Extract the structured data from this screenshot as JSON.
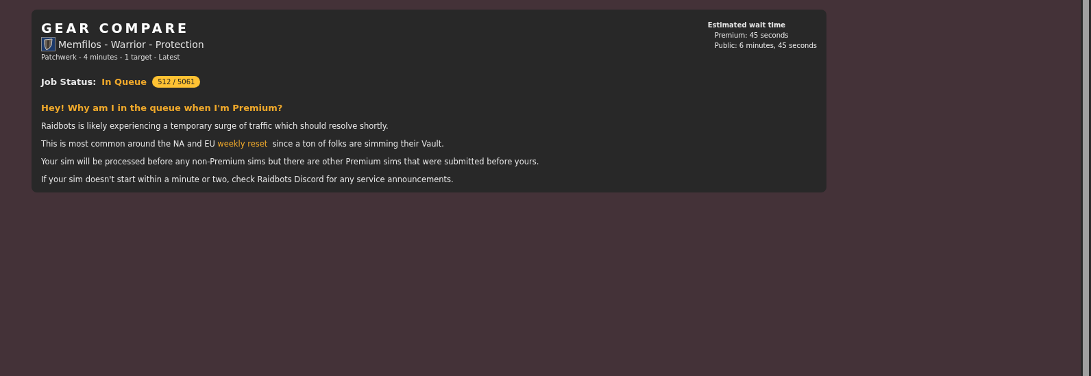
{
  "header": {
    "title": "GEAR COMPARE",
    "character": "Memfilos - Warrior - Protection",
    "details": "Patchwerk - 4 minutes - 1 target - Latest"
  },
  "wait_time": {
    "heading": "Estimated wait time",
    "lines": [
      "Premium: 45 seconds",
      "Public: 6 minutes, 45 seconds"
    ]
  },
  "job_status": {
    "label": "Job Status:",
    "status": "In Queue",
    "position": "512 / 5061"
  },
  "faq": {
    "question": "Hey! Why am I in the queue when I'm Premium?",
    "paragraphs": [
      {
        "text": "Raidbots is likely experiencing a temporary surge of traffic which should resolve shortly."
      },
      {
        "text": "This is most common around the NA and EU",
        "link": "weekly reset",
        "after": "since a ton of folks are simming their Vault."
      },
      {
        "text": "Your sim will be processed before any non-Premium sims but there are other Premium sims that were submitted before yours."
      },
      {
        "text": "If your sim doesn't start within a minute or two, check Raidbots Discord for any service announcements."
      }
    ]
  }
}
